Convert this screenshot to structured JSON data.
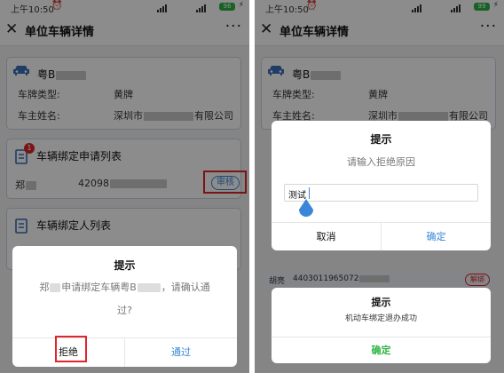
{
  "status_bar": {
    "time": "上午10:50",
    "battery": "96",
    "battery_right": "99"
  },
  "navbar": {
    "title": "单位车辆详情",
    "more": "···"
  },
  "vehicle_card": {
    "plate": "粤B",
    "plate_type_label": "车牌类型:",
    "plate_type_value": "黄牌",
    "owner_label": "车主姓名:",
    "owner_prefix": "深圳市",
    "owner_suffix": "有限公司",
    "owner_suffix_right": "有限公司",
    "owner_prefix_right": "深圳市"
  },
  "binding_requests": {
    "title": "车辆绑定申请列表",
    "badge": "1",
    "person": "郑",
    "id_prefix": "42098",
    "review_button": "审核"
  },
  "binders": {
    "title": "车辆绑定人列表"
  },
  "left_dialog": {
    "title": "提示",
    "message_prefix": "郑",
    "message_mid": "申请绑定车辆粤B",
    "message_end": "，请确认通",
    "message_line2": "过?",
    "reject": "拒绝",
    "approve": "通过"
  },
  "right_dialog": {
    "title": "提示",
    "message": "请输入拒绝原因",
    "input_value": "测试",
    "cancel": "取消",
    "confirm": "确定"
  },
  "right_bg_row": {
    "person": "胡亮",
    "id": "4403011965072",
    "badge": "解绑"
  },
  "success_dialog": {
    "title": "提示",
    "message": "机动车绑定退办成功",
    "confirm": "确定"
  },
  "colors": {
    "accent": "#3a86d8",
    "confirm_green": "#2fb344",
    "highlight_red": "#e0252b"
  }
}
